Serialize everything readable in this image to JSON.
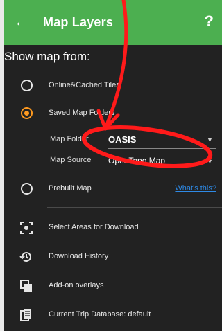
{
  "appbar": {
    "back_icon": "arrow-left-icon",
    "title": "Map Layers",
    "help_label": "?"
  },
  "heading": "Show map from:",
  "options": {
    "online": {
      "label": "Online&Cached Tiles",
      "selected": false
    },
    "saved": {
      "label": "Saved Map Folders",
      "selected": true
    },
    "prebuilt": {
      "label": "Prebuilt Map",
      "selected": false,
      "link": "What's this?"
    }
  },
  "saved_settings": {
    "map_folder_label": "Map Folder",
    "map_folder_value": "OASIS",
    "map_source_label": "Map Source",
    "map_source_value": "OpenTopo Map"
  },
  "menu": [
    {
      "label": "Select Areas for Download",
      "icon": "select-area-icon"
    },
    {
      "label": "Download History",
      "icon": "history-icon"
    },
    {
      "label": "Add-on overlays",
      "icon": "layers-copy-icon"
    },
    {
      "label": "Current Trip Database: default",
      "icon": "database-file-icon"
    }
  ],
  "colors": {
    "appbar": "#4caf50",
    "background": "#222222",
    "accent": "#ff9a1f",
    "link": "#2e8ae6",
    "annotation": "#ff1a1a"
  }
}
